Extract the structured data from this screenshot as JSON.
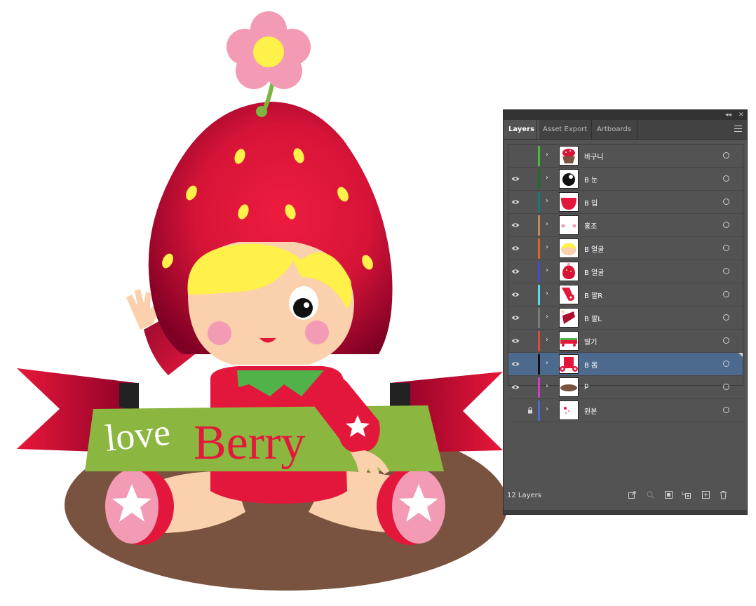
{
  "artwork": {
    "banner_word1": "love",
    "banner_word2": "Berry",
    "colors": {
      "strawberry": "#e3173c",
      "strawberry_dark": "#8a0027",
      "hair": "#fff04a",
      "skin": "#fbd0ad",
      "banner_green": "#8bb63f",
      "ground": "#7a5340",
      "pink": "#f39ab4"
    }
  },
  "panel": {
    "tabs": [
      "Layers",
      "Asset Export",
      "Artboards"
    ],
    "active_tab": "Layers",
    "layers": [
      {
        "name": "바구니",
        "color": "#41c13b",
        "visible": false,
        "locked": false,
        "selected": false,
        "thumb": "basket-icon"
      },
      {
        "name": "B 눈",
        "color": "#1c6e2a",
        "visible": true,
        "locked": false,
        "selected": false,
        "thumb": "eye-icon"
      },
      {
        "name": "B 입",
        "color": "#167a7a",
        "visible": true,
        "locked": false,
        "selected": false,
        "thumb": "mouth-icon"
      },
      {
        "name": "홍조",
        "color": "#c08a58",
        "visible": true,
        "locked": false,
        "selected": false,
        "thumb": "blush-icon"
      },
      {
        "name": "B 얼굴",
        "color": "#e0661d",
        "visible": true,
        "locked": false,
        "selected": false,
        "thumb": "face-icon"
      },
      {
        "name": "B 얼굴",
        "color": "#4a4ad0",
        "visible": true,
        "locked": false,
        "selected": false,
        "thumb": "strawberry-hat-icon"
      },
      {
        "name": "B 팔R",
        "color": "#4fe0ec",
        "visible": true,
        "locked": false,
        "selected": false,
        "thumb": "arm-right-icon"
      },
      {
        "name": "B 팔L",
        "color": "#7a7a7a",
        "visible": true,
        "locked": false,
        "selected": false,
        "thumb": "arm-left-icon"
      },
      {
        "name": "딸기",
        "color": "#e04a3a",
        "visible": true,
        "locked": false,
        "selected": false,
        "thumb": "strawberry-row-icon"
      },
      {
        "name": "B 몸",
        "color": "#111111",
        "visible": true,
        "locked": false,
        "selected": true,
        "thumb": "body-icon"
      },
      {
        "name": "p",
        "color": "#d63ad0",
        "visible": true,
        "locked": false,
        "selected": false,
        "thumb": "ground-icon"
      },
      {
        "name": "원본",
        "color": "#4a6ad8",
        "visible": false,
        "locked": true,
        "selected": false,
        "thumb": "original-icon"
      }
    ],
    "layer_count": "12 Layers"
  }
}
